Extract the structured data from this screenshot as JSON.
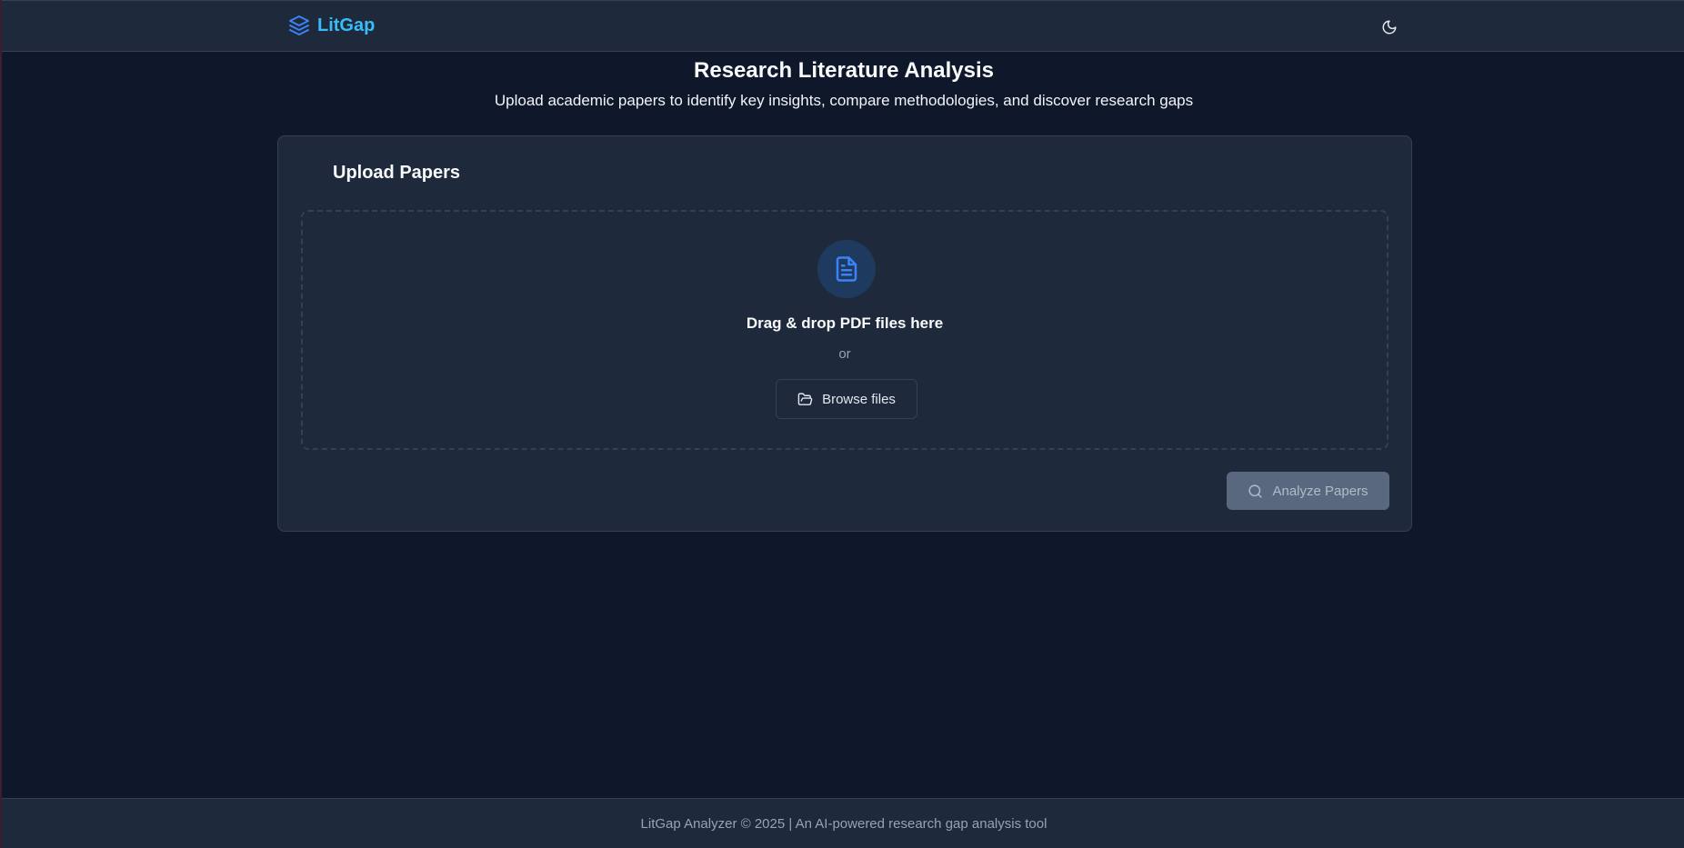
{
  "colors": {
    "background": "#0f172a",
    "surface": "#1e293b",
    "border": "#334155",
    "accent": "#38bdf8",
    "accent_icon": "#3b82f6",
    "muted": "#94a3b8",
    "disabled_button": "#64748b"
  },
  "navbar": {
    "brand_name": "LitGap",
    "brand_icon": "layers-icon",
    "theme_toggle_icon": "moon-icon"
  },
  "hero": {
    "title": "Research Literature Analysis",
    "subtitle": "Upload academic papers to identify key insights, compare methodologies, and discover research gaps"
  },
  "upload_card": {
    "title": "Upload Papers",
    "dropzone": {
      "icon": "file-text-icon",
      "title": "Drag & drop PDF files here",
      "or_text": "or",
      "browse_label": "Browse files",
      "browse_icon": "folder-open-icon"
    },
    "analyze": {
      "label": "Analyze Papers",
      "icon": "search-icon",
      "disabled": true
    }
  },
  "footer": {
    "text": "LitGap Analyzer © 2025 | An AI-powered research gap analysis tool"
  }
}
